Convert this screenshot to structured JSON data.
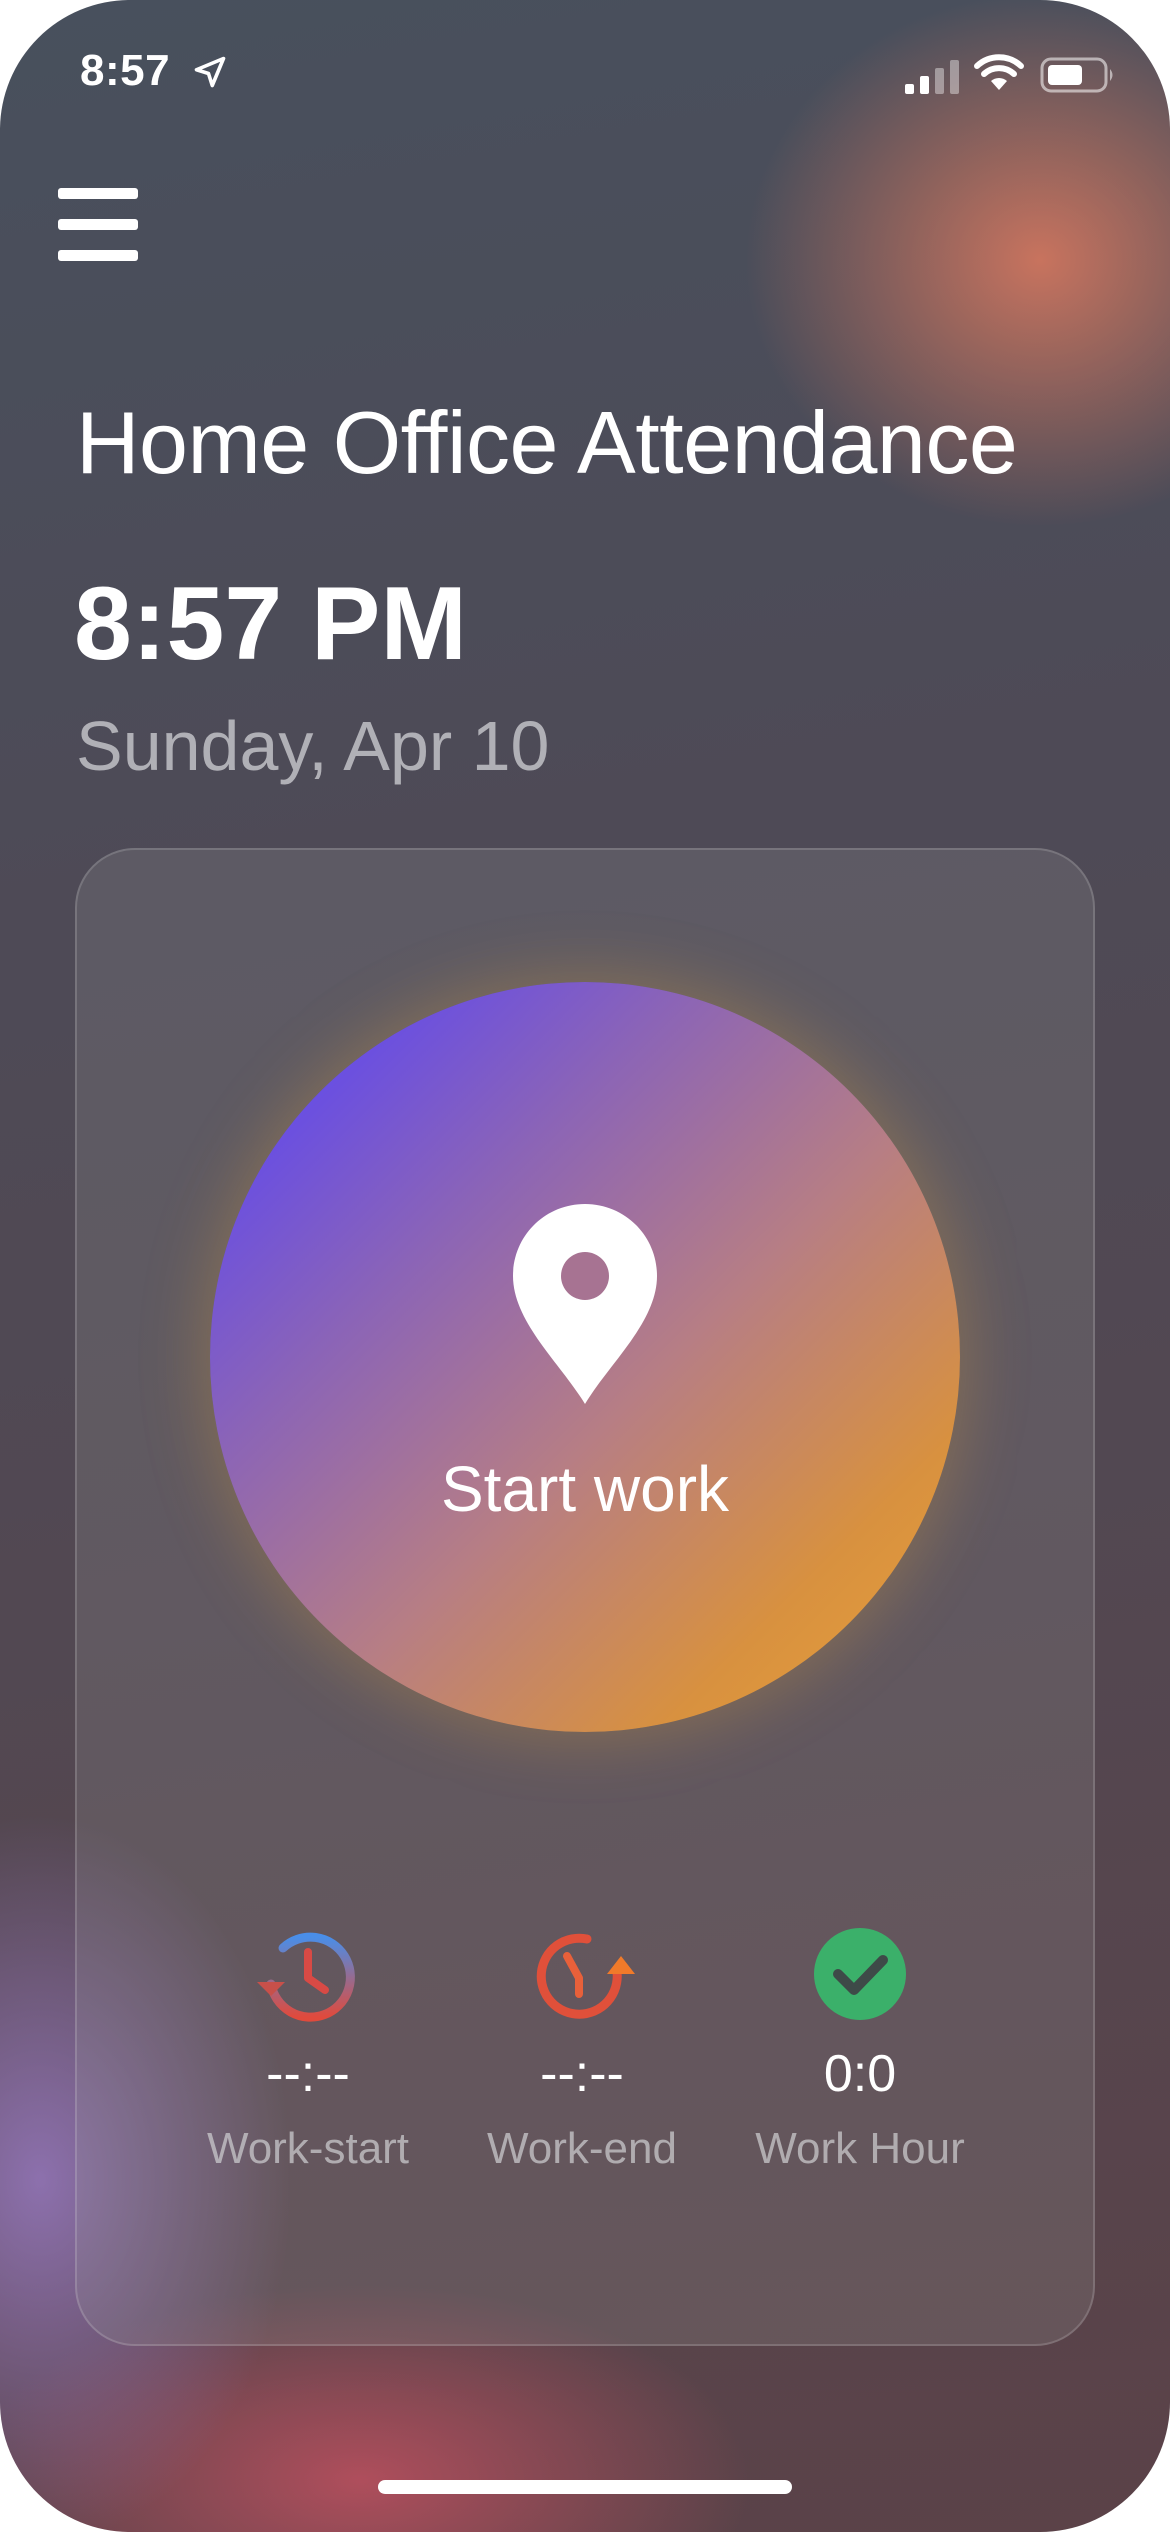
{
  "status_bar": {
    "time": "8:57"
  },
  "header": {
    "title": "Home Office Attendance"
  },
  "clock": {
    "time": "8:57 PM",
    "date": "Sunday, Apr 10"
  },
  "action": {
    "label": "Start work",
    "icon": "map-pin-icon"
  },
  "stats": [
    {
      "icon": "history-clock-icon",
      "value": "--:--",
      "label": "Work-start"
    },
    {
      "icon": "clock-forward-icon",
      "value": "--:--",
      "label": "Work-end"
    },
    {
      "icon": "check-circle-icon",
      "value": "0:0",
      "label": "Work Hour"
    }
  ],
  "colors": {
    "button_gradient_start": "#5a45f5",
    "button_gradient_end": "#eba23b",
    "check_green": "#3bb06a",
    "clock_blue": "#4a8ee8",
    "clock_red": "#e04a3c",
    "end_orange": "#f07a2a"
  }
}
